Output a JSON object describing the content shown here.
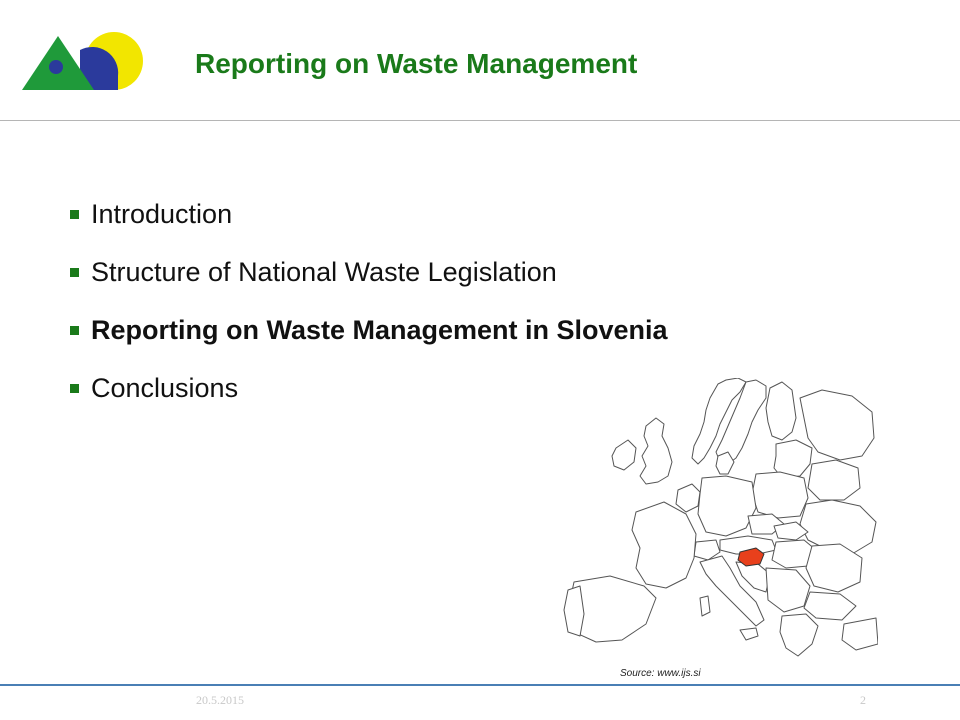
{
  "header": {
    "title": "Reporting on Waste Management"
  },
  "logo": {
    "colors": {
      "triangle": "#1f9a3a",
      "circle_yellow": "#f2e600",
      "circle_blue": "#2b3a9c",
      "dot": "#2b3a9c"
    }
  },
  "agenda": {
    "items": [
      {
        "label": "Introduction",
        "active": false
      },
      {
        "label": "Structure of National Waste Legislation",
        "active": false
      },
      {
        "label": "Reporting on Waste Management in Slovenia",
        "active": true
      },
      {
        "label": "Conclusions",
        "active": false
      }
    ],
    "bullet_color": "#1a7a1a"
  },
  "map": {
    "highlight_color": "#e8401c",
    "source": "Source: www.ijs.si"
  },
  "footer": {
    "date": "20.5.2015",
    "page": "2"
  },
  "colors": {
    "title": "#1a7a1a",
    "footer_rule": "#4a7fb5"
  }
}
